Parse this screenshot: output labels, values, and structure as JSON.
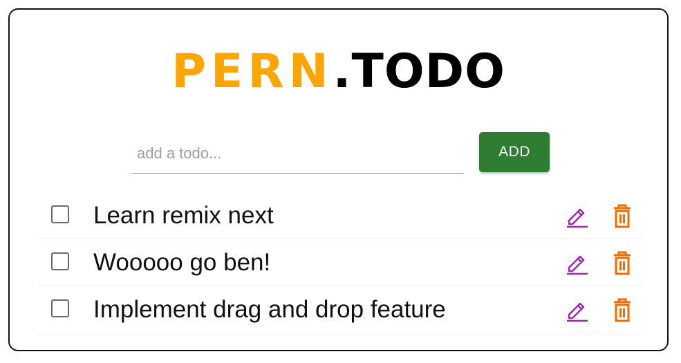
{
  "app": {
    "title_brand": "PERN",
    "title_suffix": ".TODO",
    "brand_color": "#ffa500",
    "suffix_color": "#000000"
  },
  "form": {
    "input_value": "",
    "input_placeholder": "add a todo...",
    "add_label": "ADD",
    "add_color": "#2e7d32"
  },
  "todos": [
    {
      "text": "Learn remix next",
      "completed": false
    },
    {
      "text": "Wooooo go ben!",
      "completed": false
    },
    {
      "text": "Implement drag and drop feature",
      "completed": false
    }
  ],
  "icons": {
    "checkbox": "checkbox-outline-icon",
    "edit": "pencil-icon",
    "delete": "trash-icon",
    "edit_color": "#9c27b0",
    "delete_color": "#ef6c00"
  }
}
